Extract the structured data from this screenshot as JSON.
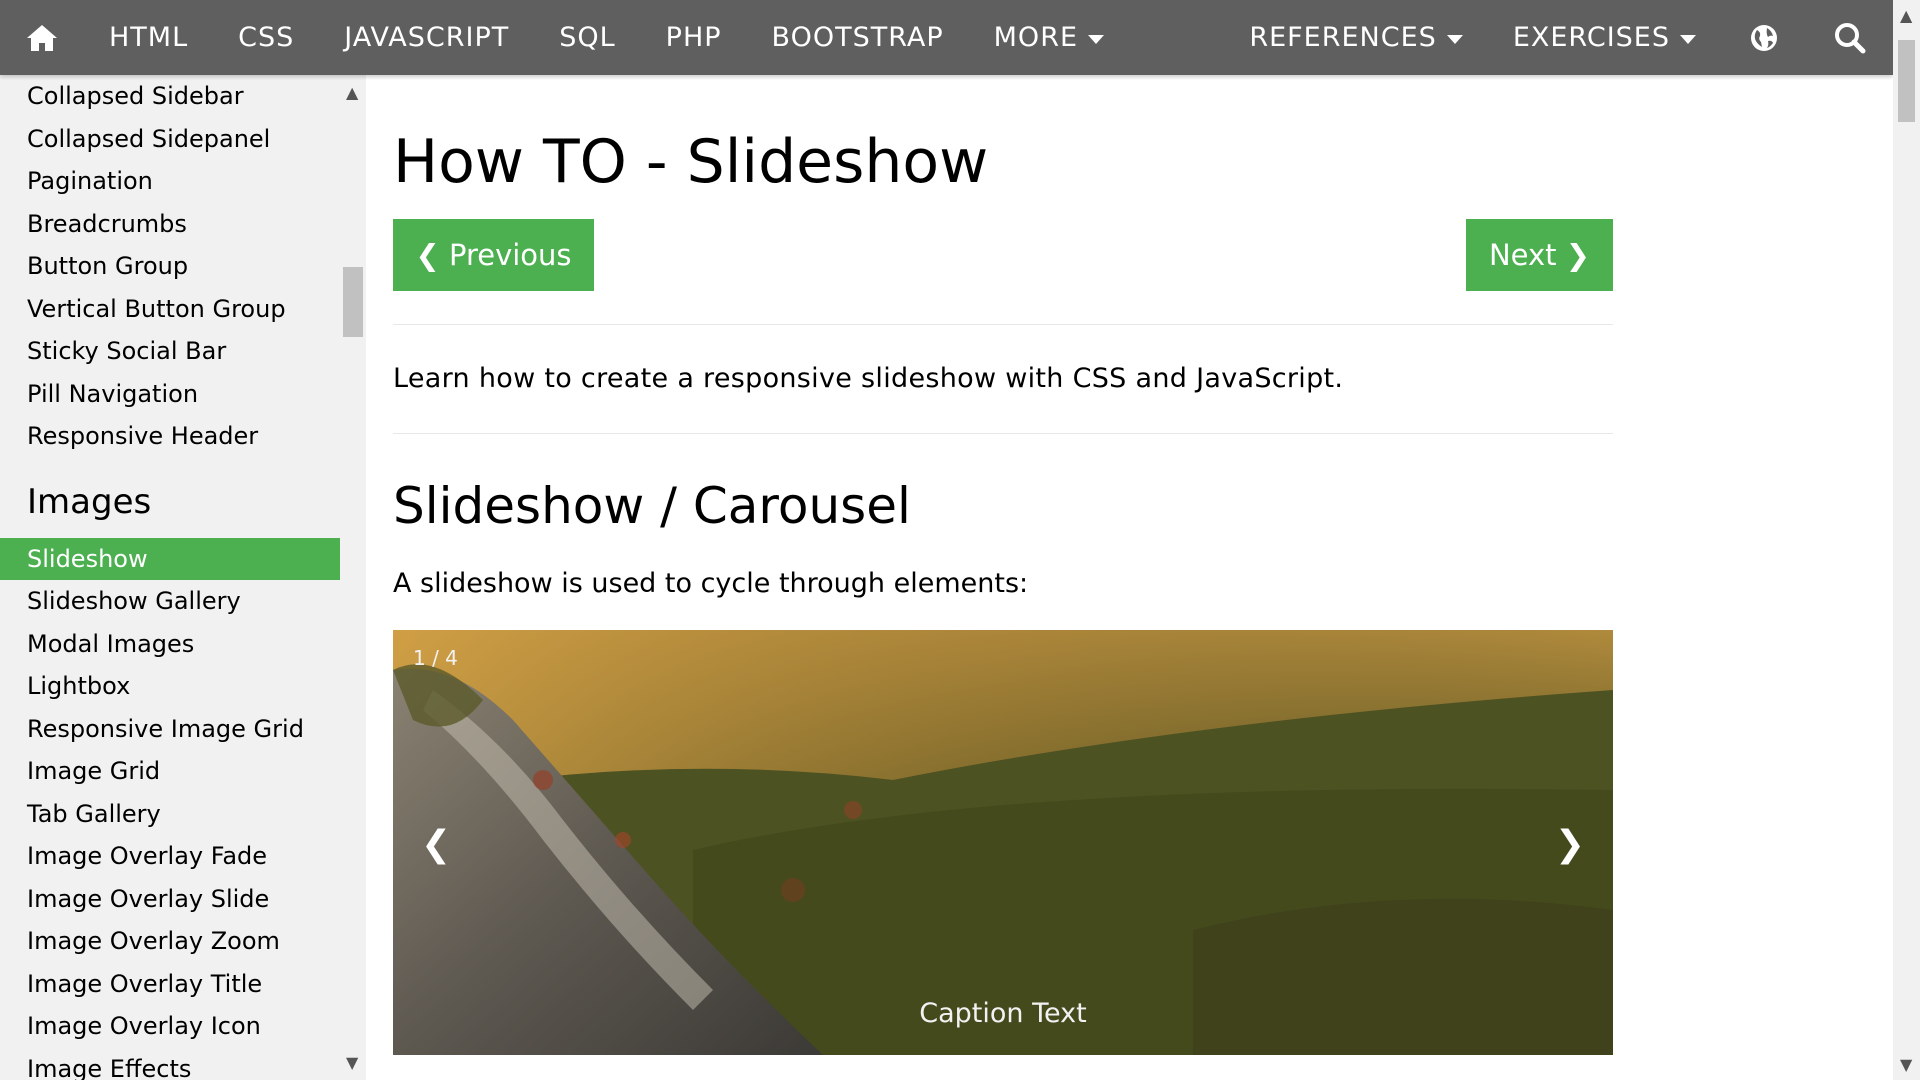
{
  "topnav": {
    "home_icon": "home-icon",
    "items": [
      "HTML",
      "CSS",
      "JAVASCRIPT",
      "SQL",
      "PHP",
      "BOOTSTRAP"
    ],
    "more_label": "MORE",
    "references_label": "REFERENCES",
    "exercises_label": "EXERCISES",
    "globe_icon": "globe-icon",
    "search_icon": "search-icon",
    "bg_color": "#5f5f5f"
  },
  "sidebar": {
    "links_top": [
      "Collapsed Sidebar",
      "Collapsed Sidepanel",
      "Pagination",
      "Breadcrumbs",
      "Button Group",
      "Vertical Button Group",
      "Sticky Social Bar",
      "Pill Navigation",
      "Responsive Header"
    ],
    "section_images": "Images",
    "links_images": [
      "Slideshow",
      "Slideshow Gallery",
      "Modal Images",
      "Lightbox",
      "Responsive Image Grid",
      "Image Grid",
      "Tab Gallery",
      "Image Overlay Fade",
      "Image Overlay Slide",
      "Image Overlay Zoom",
      "Image Overlay Title",
      "Image Overlay Icon",
      "Image Effects"
    ],
    "active": "Slideshow",
    "accent_color": "#4caf50"
  },
  "main": {
    "title": "How TO - Slideshow",
    "prev_label": "❮ Previous",
    "next_label": "Next ❯",
    "intro": "Learn how to create a responsive slideshow with CSS and JavaScript.",
    "section_title": "Slideshow / Carousel",
    "section_desc": "A slideshow is used to cycle through elements:"
  },
  "slideshow": {
    "number_text": "1 / 4",
    "caption": "Caption Text",
    "prev_arrow": "❮",
    "next_arrow": "❯"
  }
}
